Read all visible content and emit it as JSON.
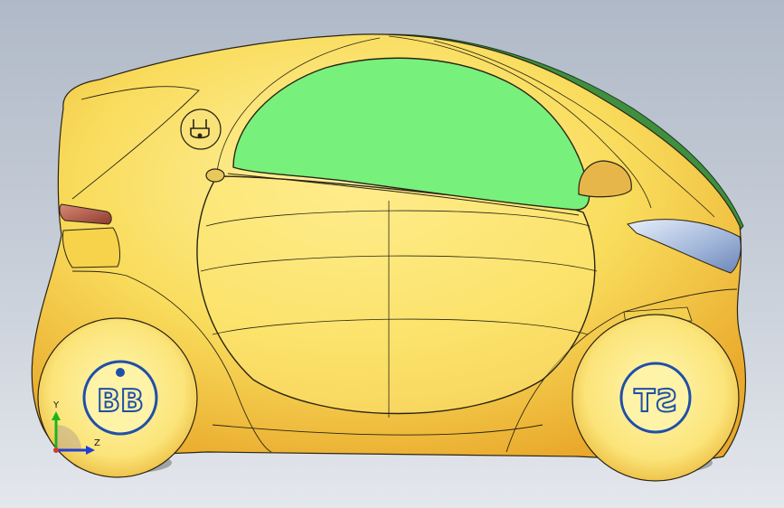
{
  "viewport": {
    "background_top": "#b0b9c7",
    "background_bottom": "#e4e7ec"
  },
  "model": {
    "body_color": "#f7d24a",
    "body_highlight": "#fbe98a",
    "outline_color": "#2a2414",
    "window_color": "#78f07c",
    "roof_color": "#3f8f3f",
    "headlight_color": "#9fb4d8",
    "taillight_color": "#b5584a",
    "logo_color": "#1f4fa8",
    "rear_badge_text": "BB",
    "front_badge_text": "ST"
  },
  "triad": {
    "y_label": "Y",
    "z_label": "Z",
    "y_color": "#1db31d",
    "z_color": "#1f3fd6",
    "x_color": "#d43a2a"
  }
}
